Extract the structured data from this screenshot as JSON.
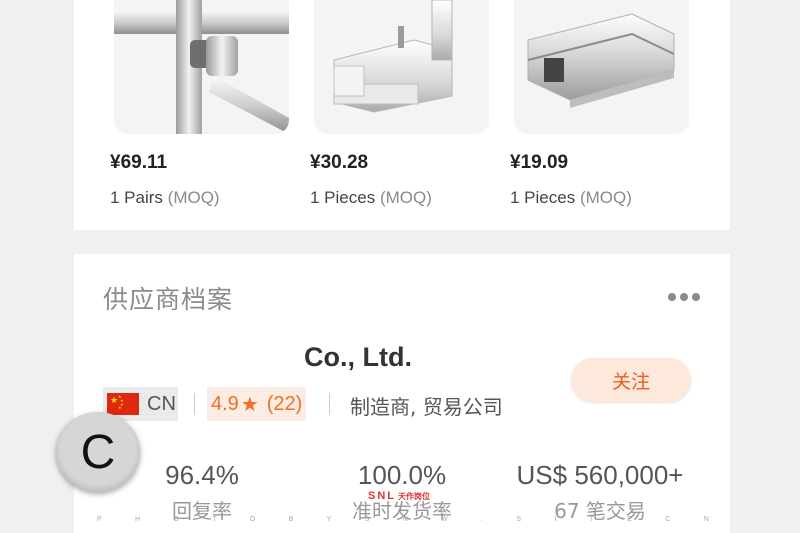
{
  "products": [
    {
      "price": "¥69.11",
      "qty": "1 Pairs",
      "moq": "(MOQ)",
      "image": "door-pull-handle"
    },
    {
      "price": "¥30.28",
      "qty": "1 Pieces",
      "moq": "(MOQ)",
      "image": "glass-patch-fitting-l"
    },
    {
      "price": "¥19.09",
      "qty": "1 Pieces",
      "moq": "(MOQ)",
      "image": "glass-clamp"
    }
  ],
  "supplier": {
    "section_title": "供应商档案",
    "more_icon": "more-horizontal-icon",
    "company_name": "Co., Ltd.",
    "follow_label": "关注",
    "country_code": "CN",
    "flag_icon": "china-flag-icon",
    "rating": "4.9",
    "star": "★",
    "reviews": "(22)",
    "business_type": "制造商, 贸易公司",
    "stats": [
      {
        "value": "96.4%",
        "label": "回复率"
      },
      {
        "value": "100.0%",
        "label": "准时发货率"
      },
      {
        "value": "US$ 560,000+",
        "label": "67 笔交易"
      }
    ]
  },
  "overlay": {
    "badge_letter": "C",
    "watermark_logo": "SNL",
    "watermark_sub": "天作岗位",
    "watermark_letters": [
      "P",
      "H",
      "O",
      "T",
      "O",
      "B",
      "Y",
      "S",
      "N",
      "W",
      ".",
      "S",
      "I",
      "T",
      "E",
      "C",
      "N"
    ]
  },
  "colors": {
    "accent": "#f05a1a",
    "follow_bg": "#fde8dc",
    "rating": "#f07020",
    "page_bg": "#f0f0f2"
  }
}
